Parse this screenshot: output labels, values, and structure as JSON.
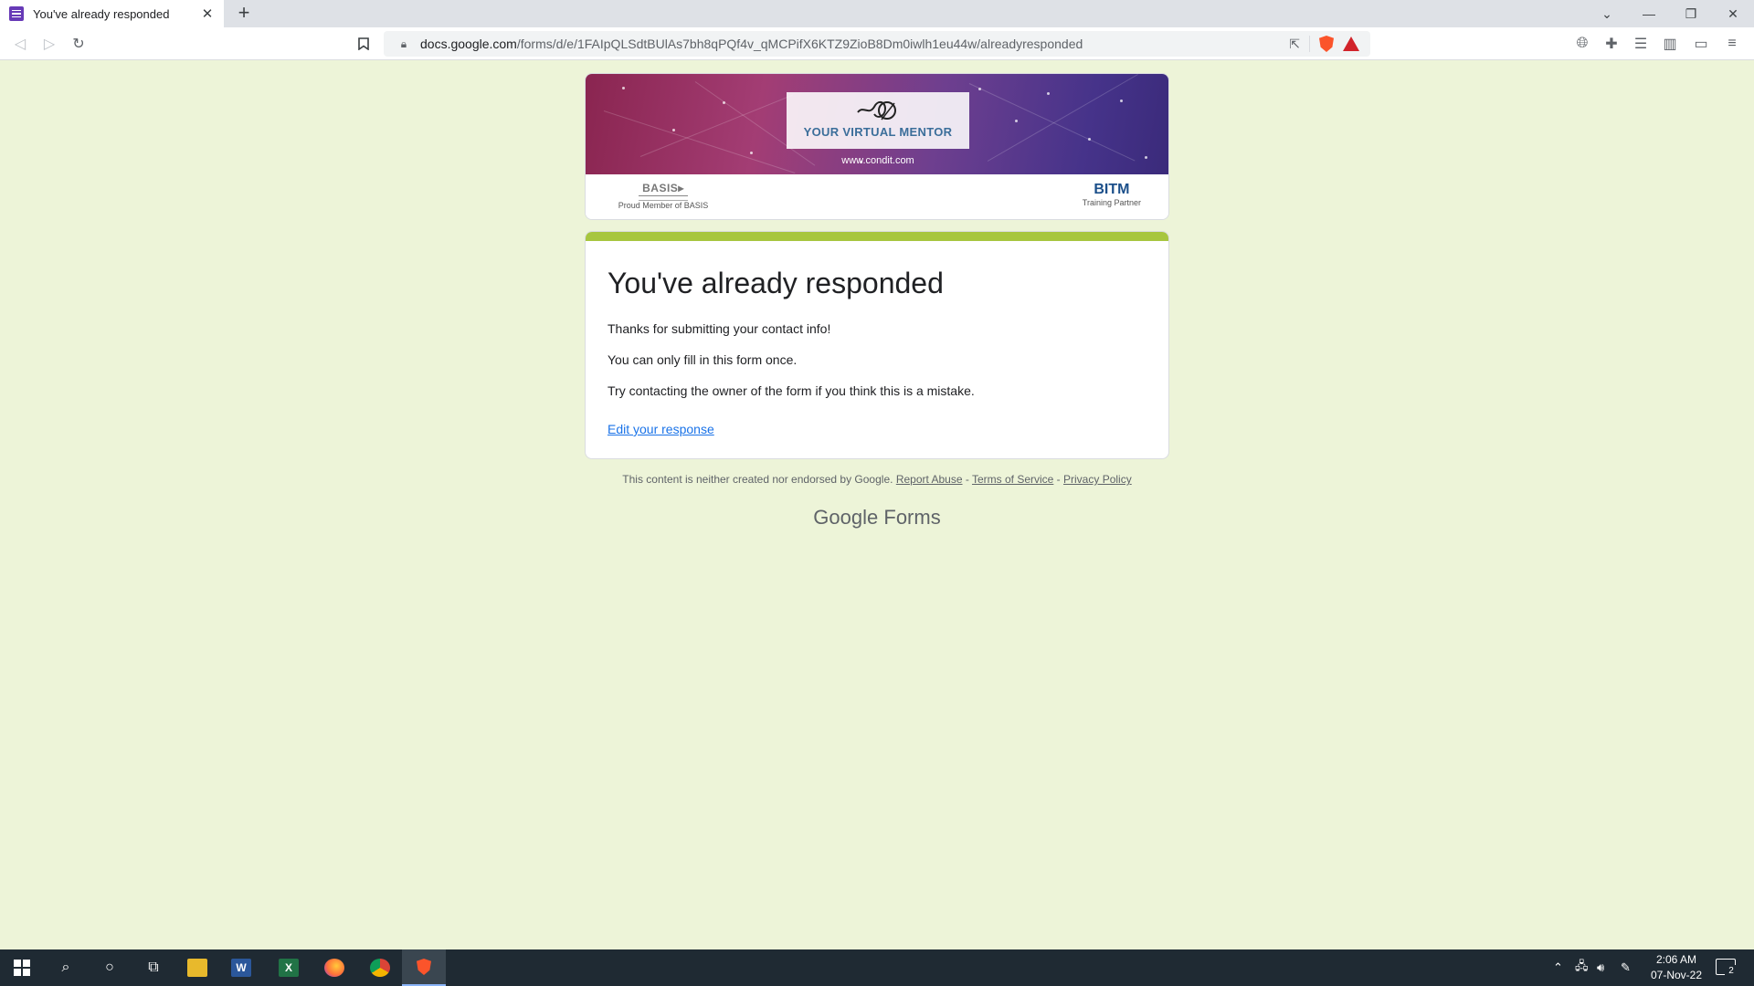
{
  "browser": {
    "tab_title": "You've already responded",
    "tab_close": "✕",
    "new_tab": "+",
    "url_host": "docs.google.com",
    "url_path": "/forms/d/e/1FAIpQLSdtBUlAs7bh8qPQf4v_qMCPifX6KTZ9ZioB8Dm0iwlh1eu44w/alreadyresponded",
    "accent_color": "#673ab7"
  },
  "banner": {
    "mentor_text": "YOUR VIRTUAL MENTOR",
    "site_url": "www.condit.com",
    "basis_logo": "BASIS",
    "basis_caption": "Proud Member of BASIS",
    "bitm_logo": "BITM",
    "bitm_caption": "Training Partner"
  },
  "card": {
    "heading": "You've already responded",
    "message_1": "Thanks for submitting your contact info!",
    "message_2": "You can only fill in this form once.",
    "message_3": "Try contacting the owner of the form if you think this is a mistake.",
    "edit_link": "Edit your response",
    "accent_color": "#a7c63f"
  },
  "footer": {
    "disclaimer": "This content is neither created nor endorsed by Google.",
    "report_abuse": "Report Abuse",
    "terms": "Terms of Service",
    "privacy": "Privacy Policy",
    "sep": " - ",
    "brand_google": "Google",
    "brand_forms": "Forms"
  },
  "taskbar": {
    "time": "2:06 AM",
    "date": "07-Nov-22",
    "notifications": "2",
    "word_letter": "W",
    "excel_letter": "X"
  }
}
